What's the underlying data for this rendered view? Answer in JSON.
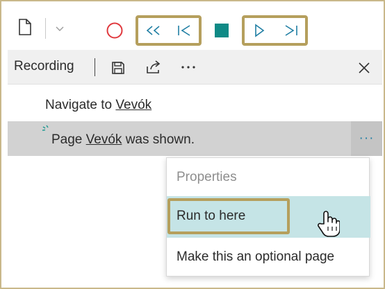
{
  "toolbar": {
    "icons": {
      "new": "new-page-icon",
      "dropdown": "chevron-down-icon",
      "record": "record-icon",
      "rewind": "rewind-icon",
      "step_back": "step-back-icon",
      "stop": "stop-icon",
      "play": "play-icon",
      "step_forward": "step-forward-icon"
    },
    "colors": {
      "record": "#e0393e",
      "stop": "#0f8a86",
      "controls": "#1f7ea3",
      "highlight": "#b59f5d"
    }
  },
  "recording": {
    "title": "Recording",
    "icons": {
      "save": "save-icon",
      "share": "share-icon",
      "more": "more-icon",
      "close": "close-icon"
    }
  },
  "steps": [
    {
      "prefix": "Navigate to ",
      "link": "Vevók",
      "suffix": ""
    },
    {
      "prefix": "Page ",
      "link": "Vevók",
      "suffix": " was shown.",
      "icon": "loading-spinner-icon",
      "more": "···"
    }
  ],
  "context_menu": {
    "items": [
      {
        "label": "Properties",
        "disabled": true
      },
      {
        "label": "Run to here",
        "highlighted": true
      },
      {
        "label": "Make this an optional page"
      }
    ],
    "hover_color": "#c5e4e6"
  },
  "cursor": "hand-pointer-icon"
}
